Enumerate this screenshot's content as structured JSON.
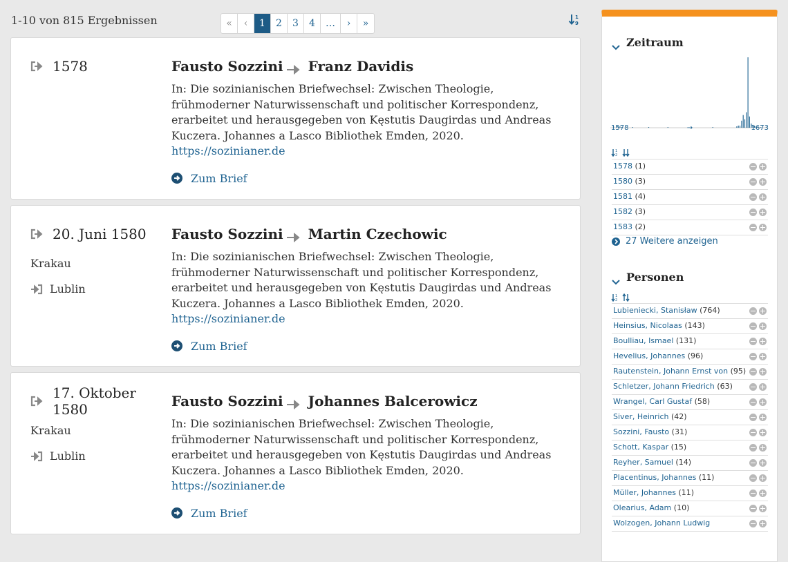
{
  "header": {
    "results_text": "1-10 von 815 Ergebnissen",
    "pagination": [
      "«",
      "‹",
      "1",
      "2",
      "3",
      "4",
      "…",
      "›",
      "»"
    ],
    "active_page": "1"
  },
  "letters": [
    {
      "date": "1578",
      "place": "",
      "destination": "",
      "sender": "Fausto Sozzini",
      "recipient": "Franz Davidis",
      "desc_text": "In: Die sozinianischen Briefwechsel: Zwischen Theologie, frühmoderner Naturwissenschaft und politischer Korrespondenz, erarbeitet und herausgegeben von Kęstutis Daugirdas und Andreas Kuczera. Johannes a Lasco Bibliothek Emden, 2020. ",
      "desc_link": "https://sozinianer.de",
      "cta": "Zum Brief"
    },
    {
      "date": "20. Juni 1580",
      "place": "Krakau",
      "destination": "Lublin",
      "sender": "Fausto Sozzini",
      "recipient": "Martin Czechowic",
      "desc_text": "In: Die sozinianischen Briefwechsel: Zwischen Theologie, frühmoderner Naturwissenschaft und politischer Korrespondenz, erarbeitet und herausgegeben von Kęstutis Daugirdas und Andreas Kuczera. Johannes a Lasco Bibliothek Emden, 2020. ",
      "desc_link": "https://sozinianer.de",
      "cta": "Zum Brief"
    },
    {
      "date": "17. Oktober 1580",
      "place": "Krakau",
      "destination": "Lublin",
      "sender": "Fausto Sozzini",
      "recipient": "Johannes Balcerowicz",
      "desc_text": "In: Die sozinianischen Briefwechsel: Zwischen Theologie, frühmoderner Naturwissenschaft und politischer Korrespondenz, erarbeitet und herausgegeben von Kęstutis Daugirdas und Andreas Kuczera. Johannes a Lasco Bibliothek Emden, 2020. ",
      "desc_link": "https://sozinianer.de",
      "cta": "Zum Brief"
    }
  ],
  "sidebar": {
    "accent_color": "#f5911e",
    "zeitraum": {
      "title": "Zeitraum",
      "range_start": "1578",
      "range_arrow": "→",
      "range_end": "1673",
      "histogram": {
        "year_range": [
          1578,
          1673
        ],
        "bars": [
          [
            1578,
            2
          ],
          [
            1580,
            3
          ],
          [
            1581,
            2
          ],
          [
            1582,
            2
          ],
          [
            1583,
            1
          ],
          [
            1590,
            1
          ],
          [
            1600,
            1
          ],
          [
            1612,
            1
          ],
          [
            1640,
            1
          ],
          [
            1655,
            2
          ],
          [
            1656,
            3
          ],
          [
            1657,
            3
          ],
          [
            1658,
            10
          ],
          [
            1659,
            18
          ],
          [
            1660,
            12
          ],
          [
            1661,
            22
          ],
          [
            1662,
            100
          ],
          [
            1663,
            16
          ],
          [
            1664,
            6
          ],
          [
            1665,
            4
          ],
          [
            1666,
            3
          ],
          [
            1667,
            2
          ],
          [
            1668,
            1
          ],
          [
            1670,
            1
          ]
        ]
      },
      "items": [
        {
          "label": "1578",
          "count": "(1)"
        },
        {
          "label": "1580",
          "count": "(3)"
        },
        {
          "label": "1581",
          "count": "(4)"
        },
        {
          "label": "1582",
          "count": "(3)"
        },
        {
          "label": "1583",
          "count": "(2)"
        }
      ],
      "more": "27 Weitere anzeigen"
    },
    "personen": {
      "title": "Personen",
      "items": [
        {
          "label": "Lubieniecki, Stanisław",
          "count": "(764)"
        },
        {
          "label": "Heinsius, Nicolaas",
          "count": "(143)"
        },
        {
          "label": "Boulliau, Ismael",
          "count": "(131)"
        },
        {
          "label": "Hevelius, Johannes",
          "count": "(96)"
        },
        {
          "label": "Rautenstein, Johann Ernst von",
          "count": "(95)"
        },
        {
          "label": "Schletzer, Johann Friedrich",
          "count": "(63)"
        },
        {
          "label": "Wrangel, Carl Gustaf",
          "count": "(58)"
        },
        {
          "label": "Siver, Heinrich",
          "count": "(42)"
        },
        {
          "label": "Sozzini, Fausto",
          "count": "(31)"
        },
        {
          "label": "Schott, Kaspar",
          "count": "(15)"
        },
        {
          "label": "Reyher, Samuel",
          "count": "(14)"
        },
        {
          "label": "Placentinus, Johannes",
          "count": "(11)"
        },
        {
          "label": "Müller, Johannes",
          "count": "(11)"
        },
        {
          "label": "Olearius, Adam",
          "count": "(10)"
        },
        {
          "label": "Wolzogen, Johann Ludwig",
          "count": ""
        }
      ]
    }
  }
}
